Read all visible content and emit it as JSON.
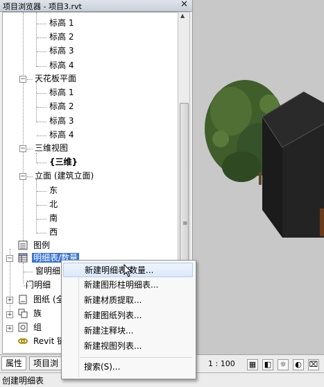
{
  "browser": {
    "title": "项目浏览器 - 项目3.rvt",
    "close_glyph": "✕",
    "tree": {
      "level_items_top": [
        "标高 1",
        "标高 2",
        "标高 3",
        "标高 4"
      ],
      "ceiling_plans": {
        "label": "天花板平面",
        "items": [
          "标高 1",
          "标高 2",
          "标高 3",
          "标高 4"
        ]
      },
      "views_3d": {
        "label": "三维视图",
        "items": [
          "{三维}"
        ]
      },
      "elevations": {
        "label": "立面 (建筑立面)",
        "items": [
          "东",
          "北",
          "南",
          "西"
        ]
      },
      "legends": "图例",
      "schedules": {
        "label": "明细表/数量",
        "items": [
          "窗明细",
          "门明细"
        ]
      },
      "sheets": "图纸 (全",
      "families": "族",
      "groups": "组",
      "revit_links": "Revit 链"
    },
    "tabs": [
      "属性",
      "项目浏"
    ]
  },
  "context_menu": {
    "items": [
      "新建明细表/数量...",
      "新建图形柱明细表...",
      "新建材质提取...",
      "新建图纸列表...",
      "新建注释块...",
      "新建视图列表..."
    ],
    "search": "搜索(S)..."
  },
  "view": {
    "scale": "1 : 100"
  },
  "status": {
    "text": "创建明细表"
  },
  "colors": {
    "selection": "#3875d7",
    "menu_hover": "#dce9f9",
    "foliage": "#3f5e2a",
    "building": "#1e1e1e"
  },
  "icons": [
    "expand-icon",
    "collapse-icon",
    "legend-icon",
    "schedule-icon",
    "sheet-icon",
    "family-icon",
    "group-icon",
    "link-icon",
    "mouse-cursor-icon"
  ]
}
